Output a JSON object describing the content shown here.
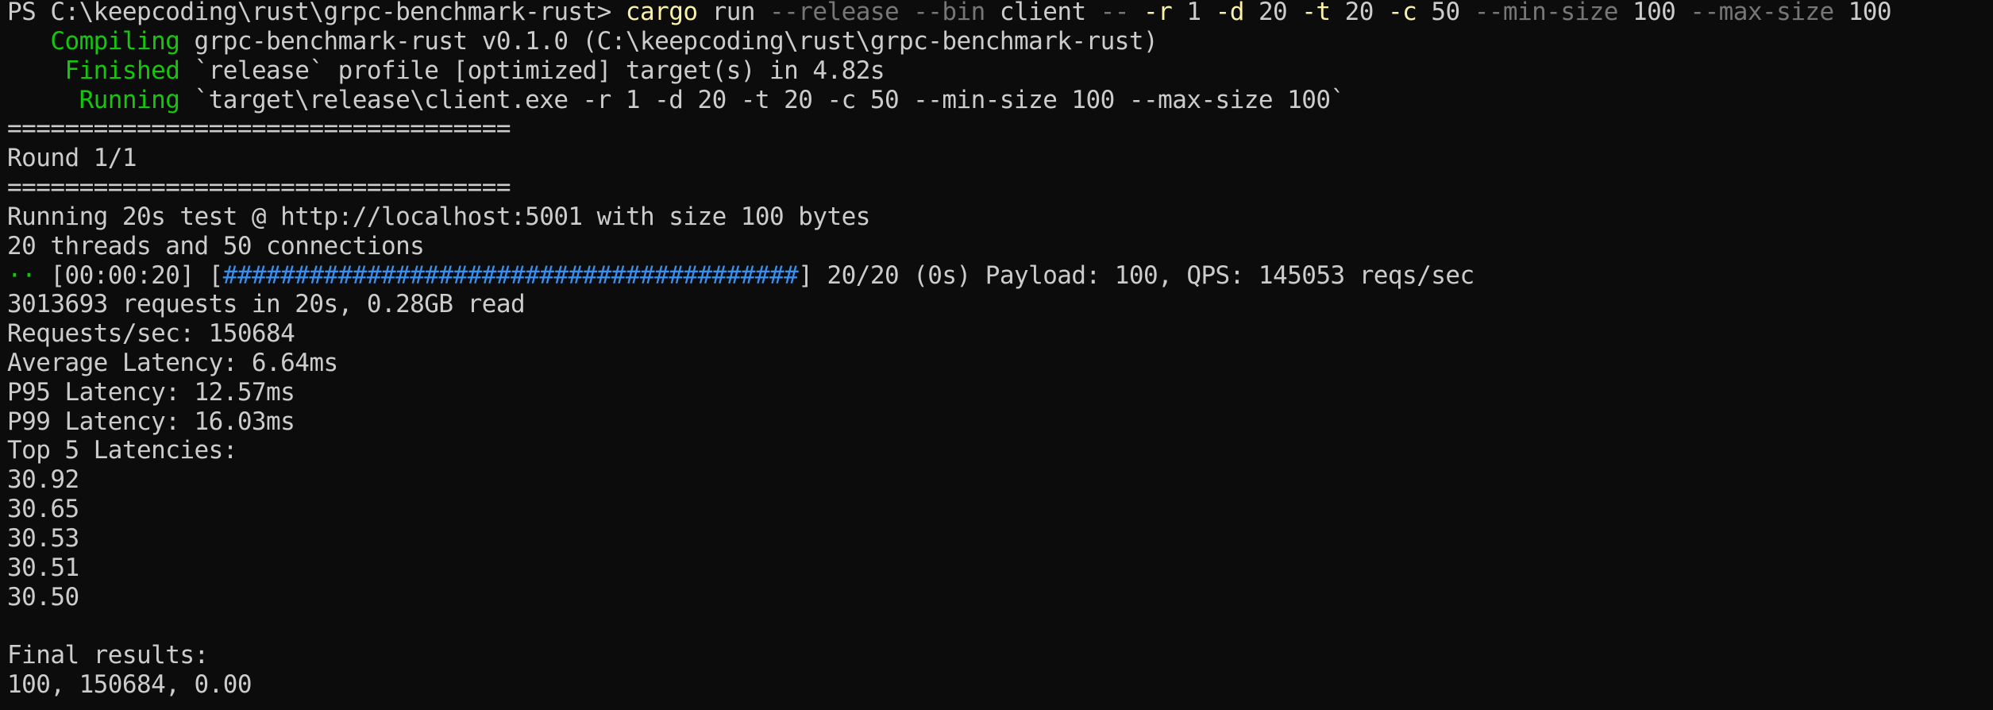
{
  "terminal": {
    "prompt": "PS C:\\keepcoding\\rust\\grpc-benchmark-rust> ",
    "cmd": {
      "cargo": "cargo",
      "run": " run ",
      "release_flag": "--release",
      "bin_flag": " --bin ",
      "client": "client ",
      "dashdash": "-- ",
      "r_flag": "-r",
      "r_val": " 1 ",
      "d_flag": "-d",
      "d_val": " 20 ",
      "t_flag": "-t",
      "t_val": " 20 ",
      "c_flag": "-c",
      "c_val": " 50 ",
      "min_flag": "--min-size",
      "min_val": " 100 ",
      "max_flag": "--max-size",
      "max_val": " 100"
    },
    "compiling": {
      "label": "   Compiling",
      "text": " grpc-benchmark-rust v0.1.0 (C:\\keepcoding\\rust\\grpc-benchmark-rust)"
    },
    "finished": {
      "label": "    Finished",
      "text": " `release` profile [optimized] target(s) in 4.82s"
    },
    "running": {
      "label": "     Running",
      "text": " `target\\release\\client.exe -r 1 -d 20 -t 20 -c 50 --min-size 100 --max-size 100`"
    },
    "separator": "===================================",
    "round": "Round 1/1",
    "test_info": "Running 20s test @ http://localhost:5001 with size 100 bytes",
    "threads_info": "20 threads and 50 connections",
    "progress": {
      "spinner": "··",
      "time": " [00:00:20] [",
      "bar": "########################################",
      "suffix": "] 20/20 (0s) Payload: 100, QPS: 145053 reqs/sec"
    },
    "summary": "3013693 requests in 20s, 0.28GB read",
    "rps": "Requests/sec: 150684",
    "avg_latency": "Average Latency: 6.64ms",
    "p95": "P95 Latency: 12.57ms",
    "p99": "P99 Latency: 16.03ms",
    "top5_title": "Top 5 Latencies:",
    "top5": [
      "30.92",
      "30.65",
      "30.53",
      "30.51",
      "30.50"
    ],
    "final_title": "Final results:",
    "final_values": "100, 150684, 0.00"
  },
  "colors": {
    "background": "#0c0c0c",
    "foreground": "#cccccc",
    "command": "#f9f1a5",
    "flag_dim": "#767676",
    "status_green": "#16c60c",
    "progress_blue": "#3b8eea"
  }
}
